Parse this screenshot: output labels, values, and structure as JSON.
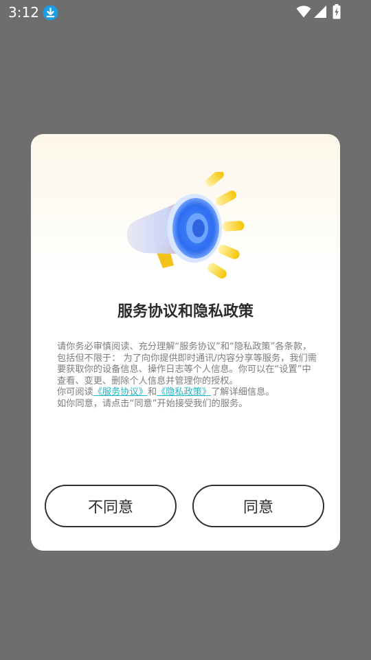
{
  "status_bar": {
    "time": "3:12",
    "icons": [
      "download-icon",
      "wifi-icon",
      "signal-icon",
      "battery-charging-icon"
    ]
  },
  "dialog": {
    "illustration": "megaphone-icon",
    "title": "服务协议和隐私政策",
    "paragraph1": "请你务必审慎阅读、充分理解“服务协议”和“隐私政策”各条款，包括但不限于：  为了向你提供即时通讯/内容分享等服务，我们需要获取你的设备信息、操作日志等个人信息。你可以在“设置”中查看、变更、删除个人信息并管理你的授权。",
    "p2_prefix": "你可阅读",
    "link_service": "《服务协议》",
    "p2_and": "和",
    "link_privacy": "《隐私政策》",
    "p2_suffix": "了解详细信息。",
    "paragraph3": "如你同意，请点击“同意”开始接受我们的服务。",
    "disagree_label": "不同意",
    "agree_label": "同意"
  },
  "colors": {
    "overlay": "#6e6e6e",
    "link": "#1bb8c6",
    "download_badge": "#1a9ee8"
  }
}
